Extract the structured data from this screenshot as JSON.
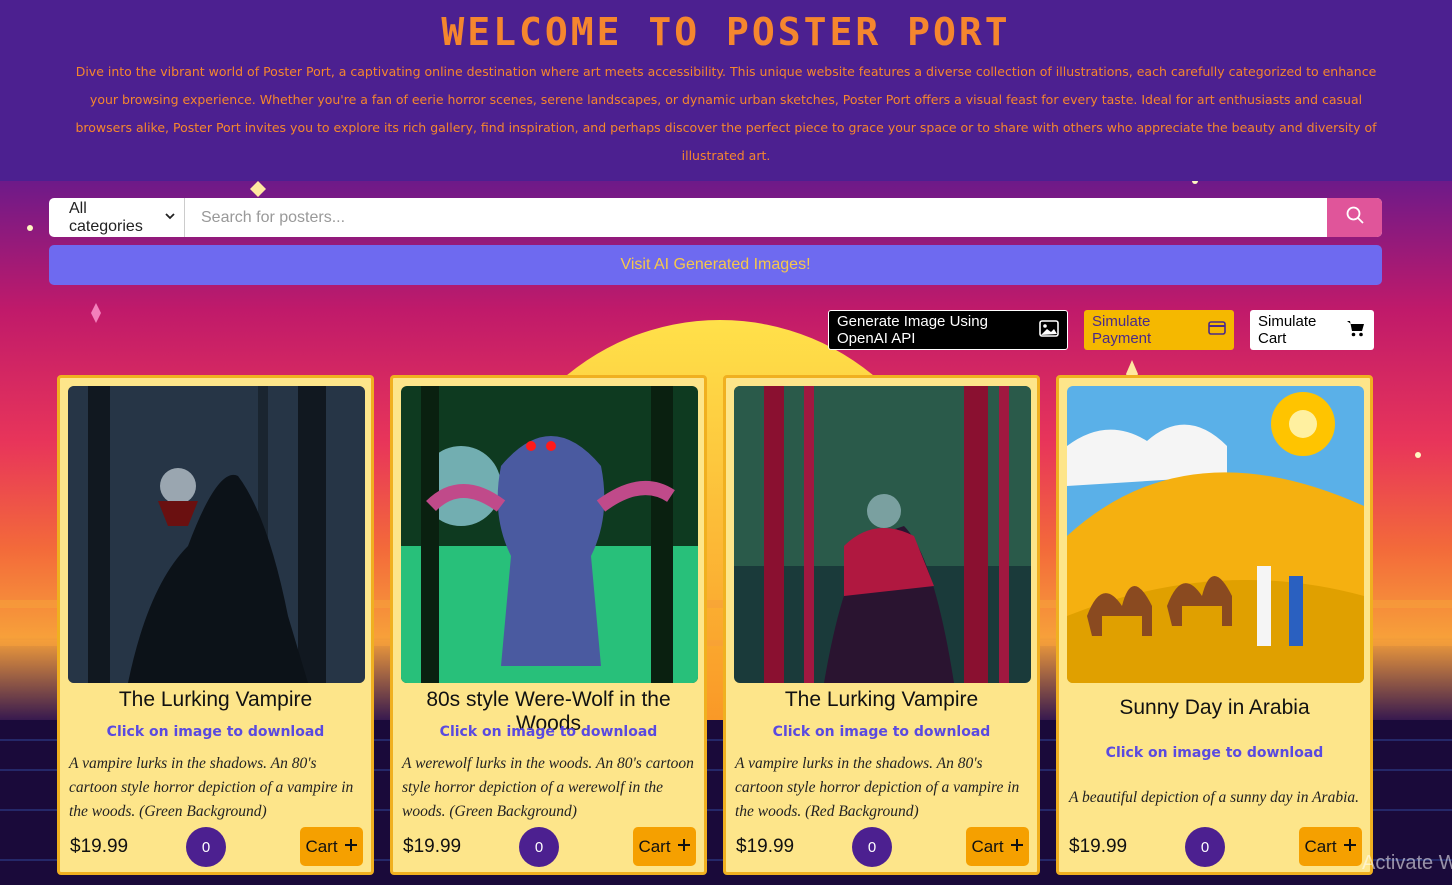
{
  "header": {
    "title": "WELCOME TO POSTER PORT",
    "intro": "Dive into the vibrant world of Poster Port, a captivating online destination where art meets accessibility. This unique website features a diverse collection of illustrations, each carefully categorized to enhance your browsing experience. Whether you're a fan of eerie horror scenes, serene landscapes, or dynamic urban sketches, Poster Port offers a visual feast for every taste. Ideal for art enthusiasts and casual browsers alike, Poster Port invites you to explore its rich gallery, find inspiration, and perhaps discover the perfect piece to grace your space or to share with others who appreciate the beauty and diversity of illustrated art."
  },
  "search": {
    "category_selected": "All categories",
    "placeholder": "Search for posters...",
    "button_icon": "search-icon"
  },
  "ai_banner": {
    "label": "Visit AI Generated Images!"
  },
  "actions": {
    "generate_label": "Generate Image Using OpenAI API",
    "generate_icon": "image-icon",
    "payment_label": "Simulate Payment",
    "payment_icon": "credit-card-icon",
    "cart_label": "Simulate Cart",
    "cart_icon": "cart-icon"
  },
  "cards": [
    {
      "title": "The Lurking Vampire",
      "download": "Click on image to download",
      "description": "A vampire lurks in the shadows. An 80's cartoon style horror depiction of a vampire in the woods. (Green Background)",
      "price": "$19.99",
      "qty": "0",
      "cart_label": "Cart"
    },
    {
      "title": "80s style Were-Wolf in the Woods",
      "download": "Click on image to download",
      "description": "A werewolf lurks in the woods. An 80's cartoon style horror depiction of a werewolf in the woods. (Green Background)",
      "price": "$19.99",
      "qty": "0",
      "cart_label": "Cart"
    },
    {
      "title": "The Lurking Vampire",
      "download": "Click on image to download",
      "description": "A vampire lurks in the shadows. An 80's cartoon style horror depiction of a vampire in the woods. (Red Background)",
      "price": "$19.99",
      "qty": "0",
      "cart_label": "Cart"
    },
    {
      "title": "Sunny Day in Arabia",
      "download": "Click on image to download",
      "description": "A beautiful depiction of a sunny day in Arabia.",
      "price": "$19.99",
      "qty": "0",
      "cart_label": "Cart"
    }
  ],
  "watermark": "Activate W",
  "colors": {
    "header_bg": "#4c2090",
    "title": "#f5862e",
    "card_bg": "#fde58a",
    "accent_pink": "#e0559a",
    "banner": "#6e6af0"
  }
}
